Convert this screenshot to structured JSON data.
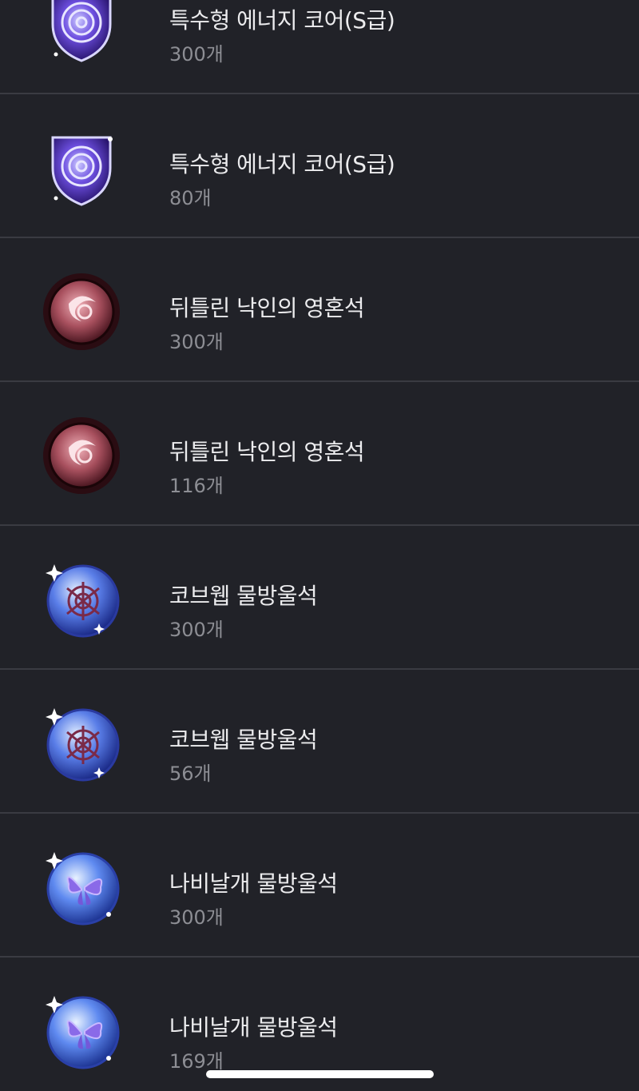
{
  "items": [
    {
      "name": "특수형 에너지 코어(S급)",
      "quantity": "300개",
      "icon": "energy-core-icon"
    },
    {
      "name": "특수형 에너지 코어(S급)",
      "quantity": "80개",
      "icon": "energy-core-icon"
    },
    {
      "name": "뒤틀린 낙인의 영혼석",
      "quantity": "300개",
      "icon": "soul-stone-icon"
    },
    {
      "name": "뒤틀린 낙인의 영혼석",
      "quantity": "116개",
      "icon": "soul-stone-icon"
    },
    {
      "name": "코브웹 물방울석",
      "quantity": "300개",
      "icon": "cobweb-droplet-stone-icon"
    },
    {
      "name": "코브웹 물방울석",
      "quantity": "56개",
      "icon": "cobweb-droplet-stone-icon"
    },
    {
      "name": "나비날개 물방울석",
      "quantity": "300개",
      "icon": "butterfly-droplet-stone-icon"
    },
    {
      "name": "나비날개 물방울석",
      "quantity": "169개",
      "icon": "butterfly-droplet-stone-icon"
    }
  ],
  "colors": {
    "background": "#212228",
    "divider": "#3a3b42",
    "name_text": "#ececee",
    "quantity_text": "#8d8e94"
  }
}
